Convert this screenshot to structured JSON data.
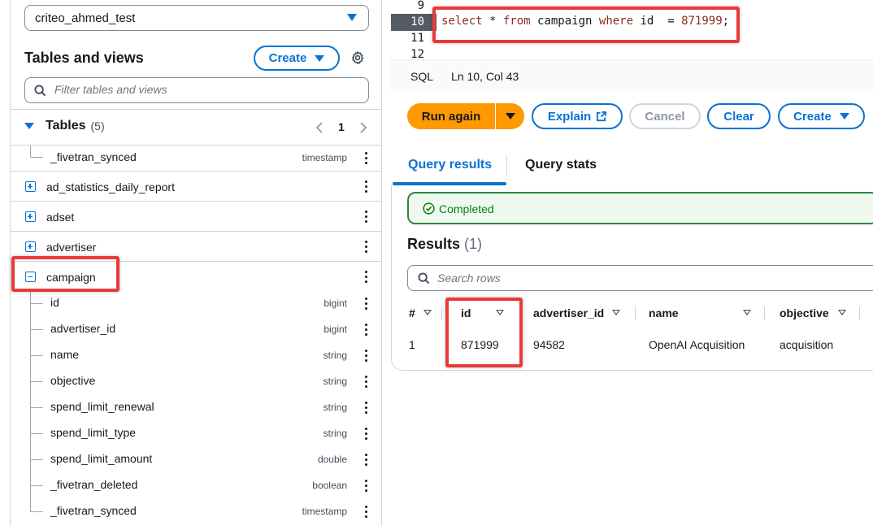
{
  "left_panel": {
    "database": "criteo_ahmed_test",
    "title": "Tables and views",
    "create_label": "Create",
    "filter_placeholder": "Filter tables and views",
    "tables_label": "Tables",
    "tables_count": "(5)",
    "page": "1",
    "top_column": {
      "name": "_fivetran_synced",
      "type": "timestamp"
    },
    "tables": [
      "ad_statistics_daily_report",
      "adset",
      "advertiser"
    ],
    "expanded_table": "campaign",
    "columns": [
      {
        "name": "id",
        "type": "bigint"
      },
      {
        "name": "advertiser_id",
        "type": "bigint"
      },
      {
        "name": "name",
        "type": "string"
      },
      {
        "name": "objective",
        "type": "string"
      },
      {
        "name": "spend_limit_renewal",
        "type": "string"
      },
      {
        "name": "spend_limit_type",
        "type": "string"
      },
      {
        "name": "spend_limit_amount",
        "type": "double"
      },
      {
        "name": "_fivetran_deleted",
        "type": "boolean"
      },
      {
        "name": "_fivetran_synced",
        "type": "timestamp"
      }
    ]
  },
  "editor": {
    "line_numbers": [
      "9",
      "10",
      "11",
      "12"
    ],
    "code": {
      "kw1": "select",
      "t1": " * ",
      "kw2": "from",
      "t2": " campaign ",
      "kw3": "where",
      "t3": " id  = ",
      "num": "871999",
      "t4": ";"
    },
    "language": "SQL",
    "cursor": "Ln 10, Col 43"
  },
  "toolbar": {
    "run_again": "Run again",
    "explain": "Explain",
    "cancel": "Cancel",
    "clear": "Clear",
    "create": "Create"
  },
  "tabs": {
    "results": "Query results",
    "stats": "Query stats"
  },
  "status": "Completed",
  "results": {
    "title": "Results",
    "count": "(1)",
    "search_placeholder": "Search rows",
    "headers": [
      "#",
      "id",
      "advertiser_id",
      "name",
      "objective"
    ],
    "rows": [
      [
        "1",
        "871999",
        "94582",
        "OpenAI Acquisition",
        "acquisition"
      ]
    ]
  },
  "colors": {
    "accent": "#0972d3",
    "run": "#ff9900",
    "highlight": "#e83a3a",
    "success": "#037f0c"
  }
}
